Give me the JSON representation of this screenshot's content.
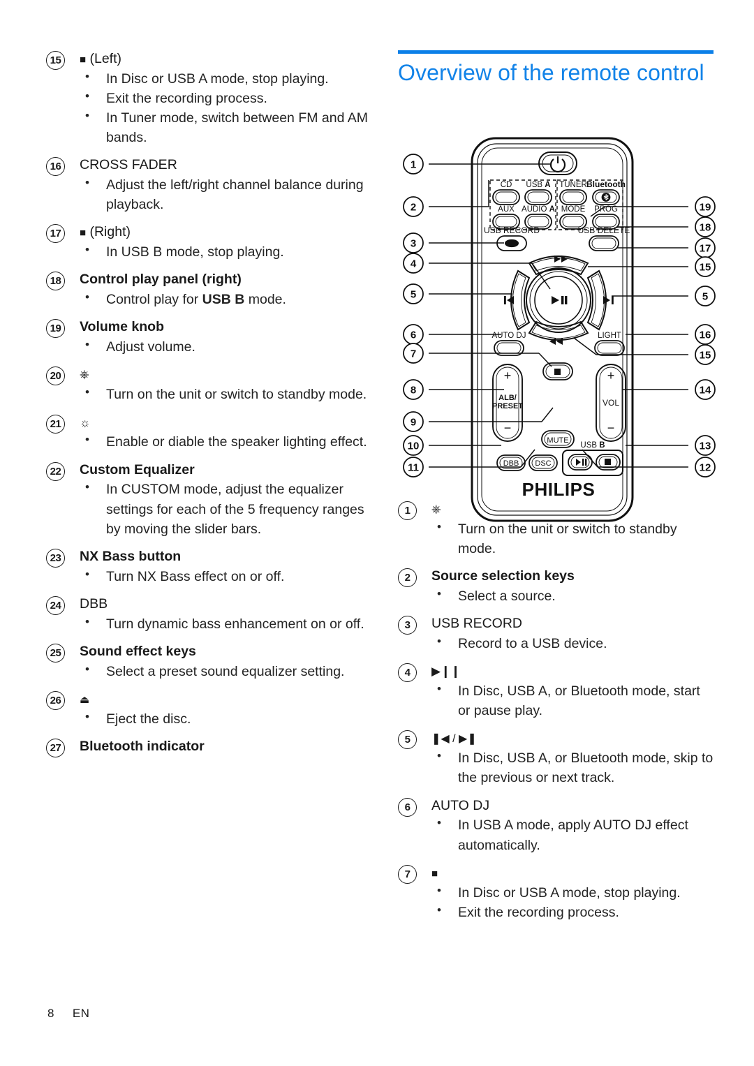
{
  "footer": {
    "page": "8",
    "lang": "EN"
  },
  "left_column": {
    "items": [
      {
        "num": "15",
        "title_icon": "stop-square",
        "title": "(Left)",
        "bold": false,
        "bullets": [
          "In Disc or USB A mode, stop playing.",
          "Exit the recording process.",
          "In Tuner mode, switch between FM and AM bands."
        ]
      },
      {
        "num": "16",
        "title_icon": "",
        "title": "CROSS FADER",
        "bold": false,
        "bullets": [
          " Adjust the left/right channel balance during playback."
        ]
      },
      {
        "num": "17",
        "title_icon": "stop-square",
        "title": "(Right)",
        "bold": false,
        "bullets": [
          "In USB B mode, stop playing."
        ]
      },
      {
        "num": "18",
        "title_icon": "",
        "title": "Control play panel (right)",
        "bold": true,
        "bullets": [
          "Control play for <b>USB B</b> mode."
        ]
      },
      {
        "num": "19",
        "title_icon": "",
        "title": "Volume knob",
        "bold": true,
        "bullets": [
          "Adjust volume."
        ]
      },
      {
        "num": "20",
        "title_icon": "power",
        "title": "",
        "bold": false,
        "bullets": [
          "Turn on the unit or switch to standby mode."
        ]
      },
      {
        "num": "21",
        "title_icon": "light-sun",
        "title": "",
        "bold": false,
        "bullets": [
          "Enable or diable the speaker lighting effect."
        ]
      },
      {
        "num": "22",
        "title_icon": "",
        "title": "Custom Equalizer",
        "bold": true,
        "bullets": [
          "In CUSTOM mode, adjust the equalizer settings for each of the 5 frequency ranges by moving the slider bars."
        ]
      },
      {
        "num": "23",
        "title_icon": "",
        "title": "NX Bass button",
        "bold": true,
        "bullets": [
          "Turn NX Bass effect on or off."
        ]
      },
      {
        "num": "24",
        "title_icon": "",
        "title": "DBB",
        "bold": false,
        "bullets": [
          "Turn dynamic bass enhancement on or off."
        ]
      },
      {
        "num": "25",
        "title_icon": "",
        "title": "Sound effect keys",
        "bold": true,
        "bullets": [
          "Select a preset sound equalizer setting."
        ]
      },
      {
        "num": "26",
        "title_icon": "eject",
        "title": "",
        "bold": false,
        "bullets": [
          "Eject the disc."
        ]
      },
      {
        "num": "27",
        "title_icon": "",
        "title": "Bluetooth indicator",
        "bold": true,
        "bullets": []
      }
    ]
  },
  "right_column": {
    "heading": "Overview of the remote control",
    "accent_color": "#1283e8",
    "items": [
      {
        "num": "1",
        "title_icon": "power",
        "title": "",
        "bold": false,
        "bullets": [
          "Turn on the unit or switch to standby mode."
        ]
      },
      {
        "num": "2",
        "title_icon": "",
        "title": "Source selection keys",
        "bold": true,
        "bullets": [
          "Select a source."
        ]
      },
      {
        "num": "3",
        "title_icon": "",
        "title": "USB RECORD",
        "bold": false,
        "bullets": [
          "Record to a USB device."
        ]
      },
      {
        "num": "4",
        "title_icon": "play-pause",
        "title": "",
        "bold": false,
        "bullets": [
          "In Disc, USB A, or Bluetooth mode, start or pause play."
        ]
      },
      {
        "num": "5",
        "title_icon": "prev-next",
        "title": "",
        "bold": false,
        "bullets": [
          "In Disc, USB A, or Bluetooth mode, skip to the previous or next track."
        ]
      },
      {
        "num": "6",
        "title_icon": "",
        "title": "AUTO DJ",
        "bold": false,
        "bullets": [
          "In USB A mode, apply AUTO DJ effect automatically."
        ]
      },
      {
        "num": "7",
        "title_icon": "stop-square",
        "title": "",
        "bold": false,
        "bullets": [
          "In Disc or USB A mode, stop playing.",
          "Exit the recording process."
        ]
      }
    ]
  },
  "remote_figure": {
    "brand": "PHILIPS",
    "callouts_left": [
      "1",
      "2",
      "3",
      "4",
      "5",
      "6",
      "7",
      "8",
      "9",
      "10",
      "11"
    ],
    "callouts_right": [
      "19",
      "18",
      "17",
      "15",
      "5",
      "16",
      "15",
      "14",
      "13",
      "12"
    ],
    "button_labels": {
      "power": "",
      "source_group": [
        "CD",
        "USB A",
        "TUNER",
        "Bluetooth",
        "AUX",
        "AUDIO A",
        "MODE",
        "PROG"
      ],
      "usb_record": "USB RECORD",
      "usb_delete": "USB DELETE",
      "auto_dj": "AUTO DJ",
      "light": "LIGHT",
      "alb_preset": "ALB/ PRESET",
      "vol": "VOL",
      "mute": "MUTE",
      "dbb": "DBB",
      "dsc": "DSC",
      "usb_b": "USB B"
    }
  }
}
